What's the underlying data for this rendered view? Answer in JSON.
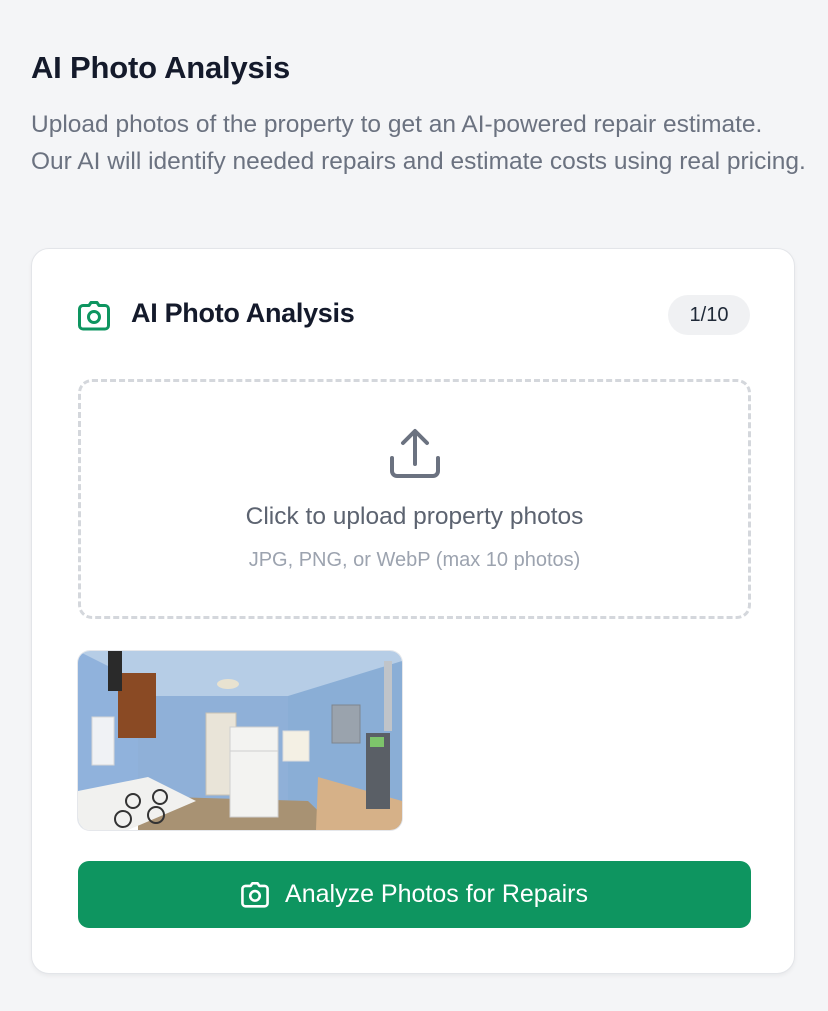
{
  "page": {
    "title": "AI Photo Analysis",
    "description": "Upload photos of the property to get an AI-powered repair estimate. Our AI will identify needed repairs and estimate costs using real pricing."
  },
  "card": {
    "title": "AI Photo Analysis",
    "photo_count": "1/10",
    "icon": "camera-icon",
    "accent_color": "#0e9560"
  },
  "upload": {
    "icon": "upload-icon",
    "title": "Click to upload property photos",
    "hint": "JPG, PNG, or WebP (max 10 photos)"
  },
  "photos": [
    {
      "name": "kitchen-photo"
    }
  ],
  "actions": {
    "analyze_label": "Analyze Photos for Repairs",
    "analyze_icon": "camera-icon",
    "button_color": "#0e9560"
  }
}
